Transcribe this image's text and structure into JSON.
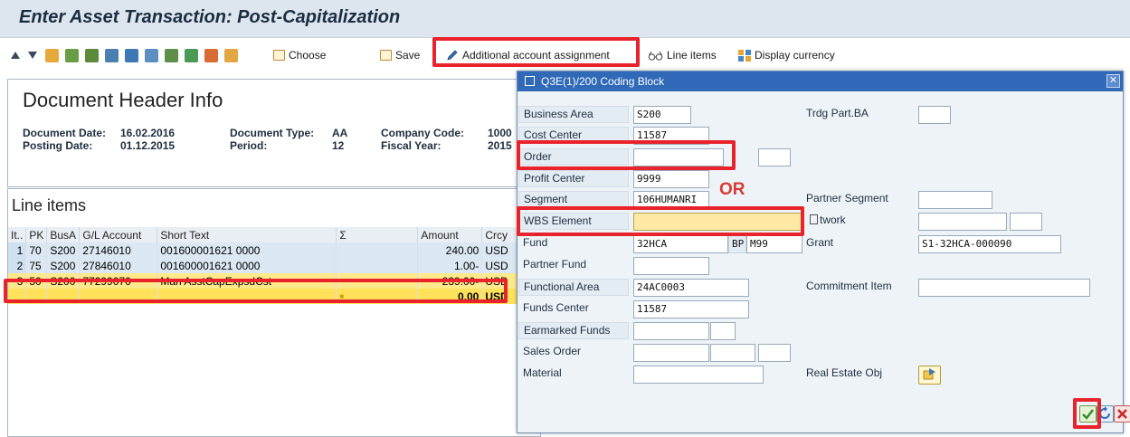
{
  "window": {
    "title": "Enter Asset Transaction: Post-Capitalization"
  },
  "toolbar": {
    "choose_label": "Choose",
    "save_label": "Save",
    "additional_account_label": "Additional account assignment",
    "line_items_label": "Line items",
    "display_currency_label": "Display currency"
  },
  "header_panel": {
    "title": "Document Header Info",
    "document_date_label": "Document Date:",
    "document_date": "16.02.2016",
    "posting_date_label": "Posting Date:",
    "posting_date": "01.12.2015",
    "document_type_label": "Document Type:",
    "document_type": "AA",
    "period_label": "Period:",
    "period": "12",
    "company_code_label": "Company Code:",
    "company_code": "1000",
    "fiscal_year_label": "Fiscal Year:",
    "fiscal_year": "2015"
  },
  "line_items": {
    "title": "Line items",
    "columns": [
      "It..",
      "PK",
      "BusA",
      "G/L Account",
      "Short Text",
      "Σ",
      "Amount",
      "Crcy"
    ],
    "rows": [
      {
        "item": "1",
        "pk": "70",
        "busa": "S200",
        "gl": "27146010",
        "text": "001600001621 0000",
        "sum": "",
        "amount": "240.00",
        "crcy": "USD"
      },
      {
        "item": "2",
        "pk": "75",
        "busa": "S200",
        "gl": "27846010",
        "text": "001600001621 0000",
        "sum": "",
        "amount": "1.00-",
        "crcy": "USD"
      },
      {
        "item": "3",
        "pk": "50",
        "busa": "S200",
        "gl": "77299070",
        "text": "Man AsstCapExpsdCst",
        "sum": "",
        "amount": "239.00-",
        "crcy": "USD"
      }
    ],
    "total": {
      "sum": "■",
      "amount": "0.00",
      "crcy": "USD"
    }
  },
  "dialog": {
    "title": "Q3E(1)/200 Coding Block",
    "business_area_label": "Business Area",
    "business_area": "S200",
    "trdg_part_ba_label": "Trdg Part.BA",
    "cost_center_label": "Cost Center",
    "cost_center": "11587",
    "order_label": "Order",
    "profit_center_label": "Profit Center",
    "profit_center": "9999",
    "segment_label": "Segment",
    "segment": "106HUMANRI",
    "partner_segment_label": "Partner Segment",
    "or_text": "OR",
    "wbs_label": "WBS Element",
    "network_label": "twork",
    "fund_label": "Fund",
    "fund": "32HCA",
    "bp_label": "BP",
    "bp": "M99",
    "grant_label": "Grant",
    "grant": "S1-32HCA-000090",
    "partner_fund_label": "Partner Fund",
    "functional_area_label": "Functional Area",
    "functional_area": "24AC0003",
    "commitment_item_label": "Commitment Item",
    "funds_center_label": "Funds Center",
    "funds_center": "11587",
    "earmarked_funds_label": "Earmarked Funds",
    "sales_order_label": "Sales Order",
    "material_label": "Material",
    "real_estate_label": "Real Estate Obj"
  },
  "colors": {
    "highlight_box": "#e8232b",
    "dialog_titlebar": "#2f69b8",
    "wbs_field": "#fde9a3",
    "total_row": "#ffe15a"
  }
}
